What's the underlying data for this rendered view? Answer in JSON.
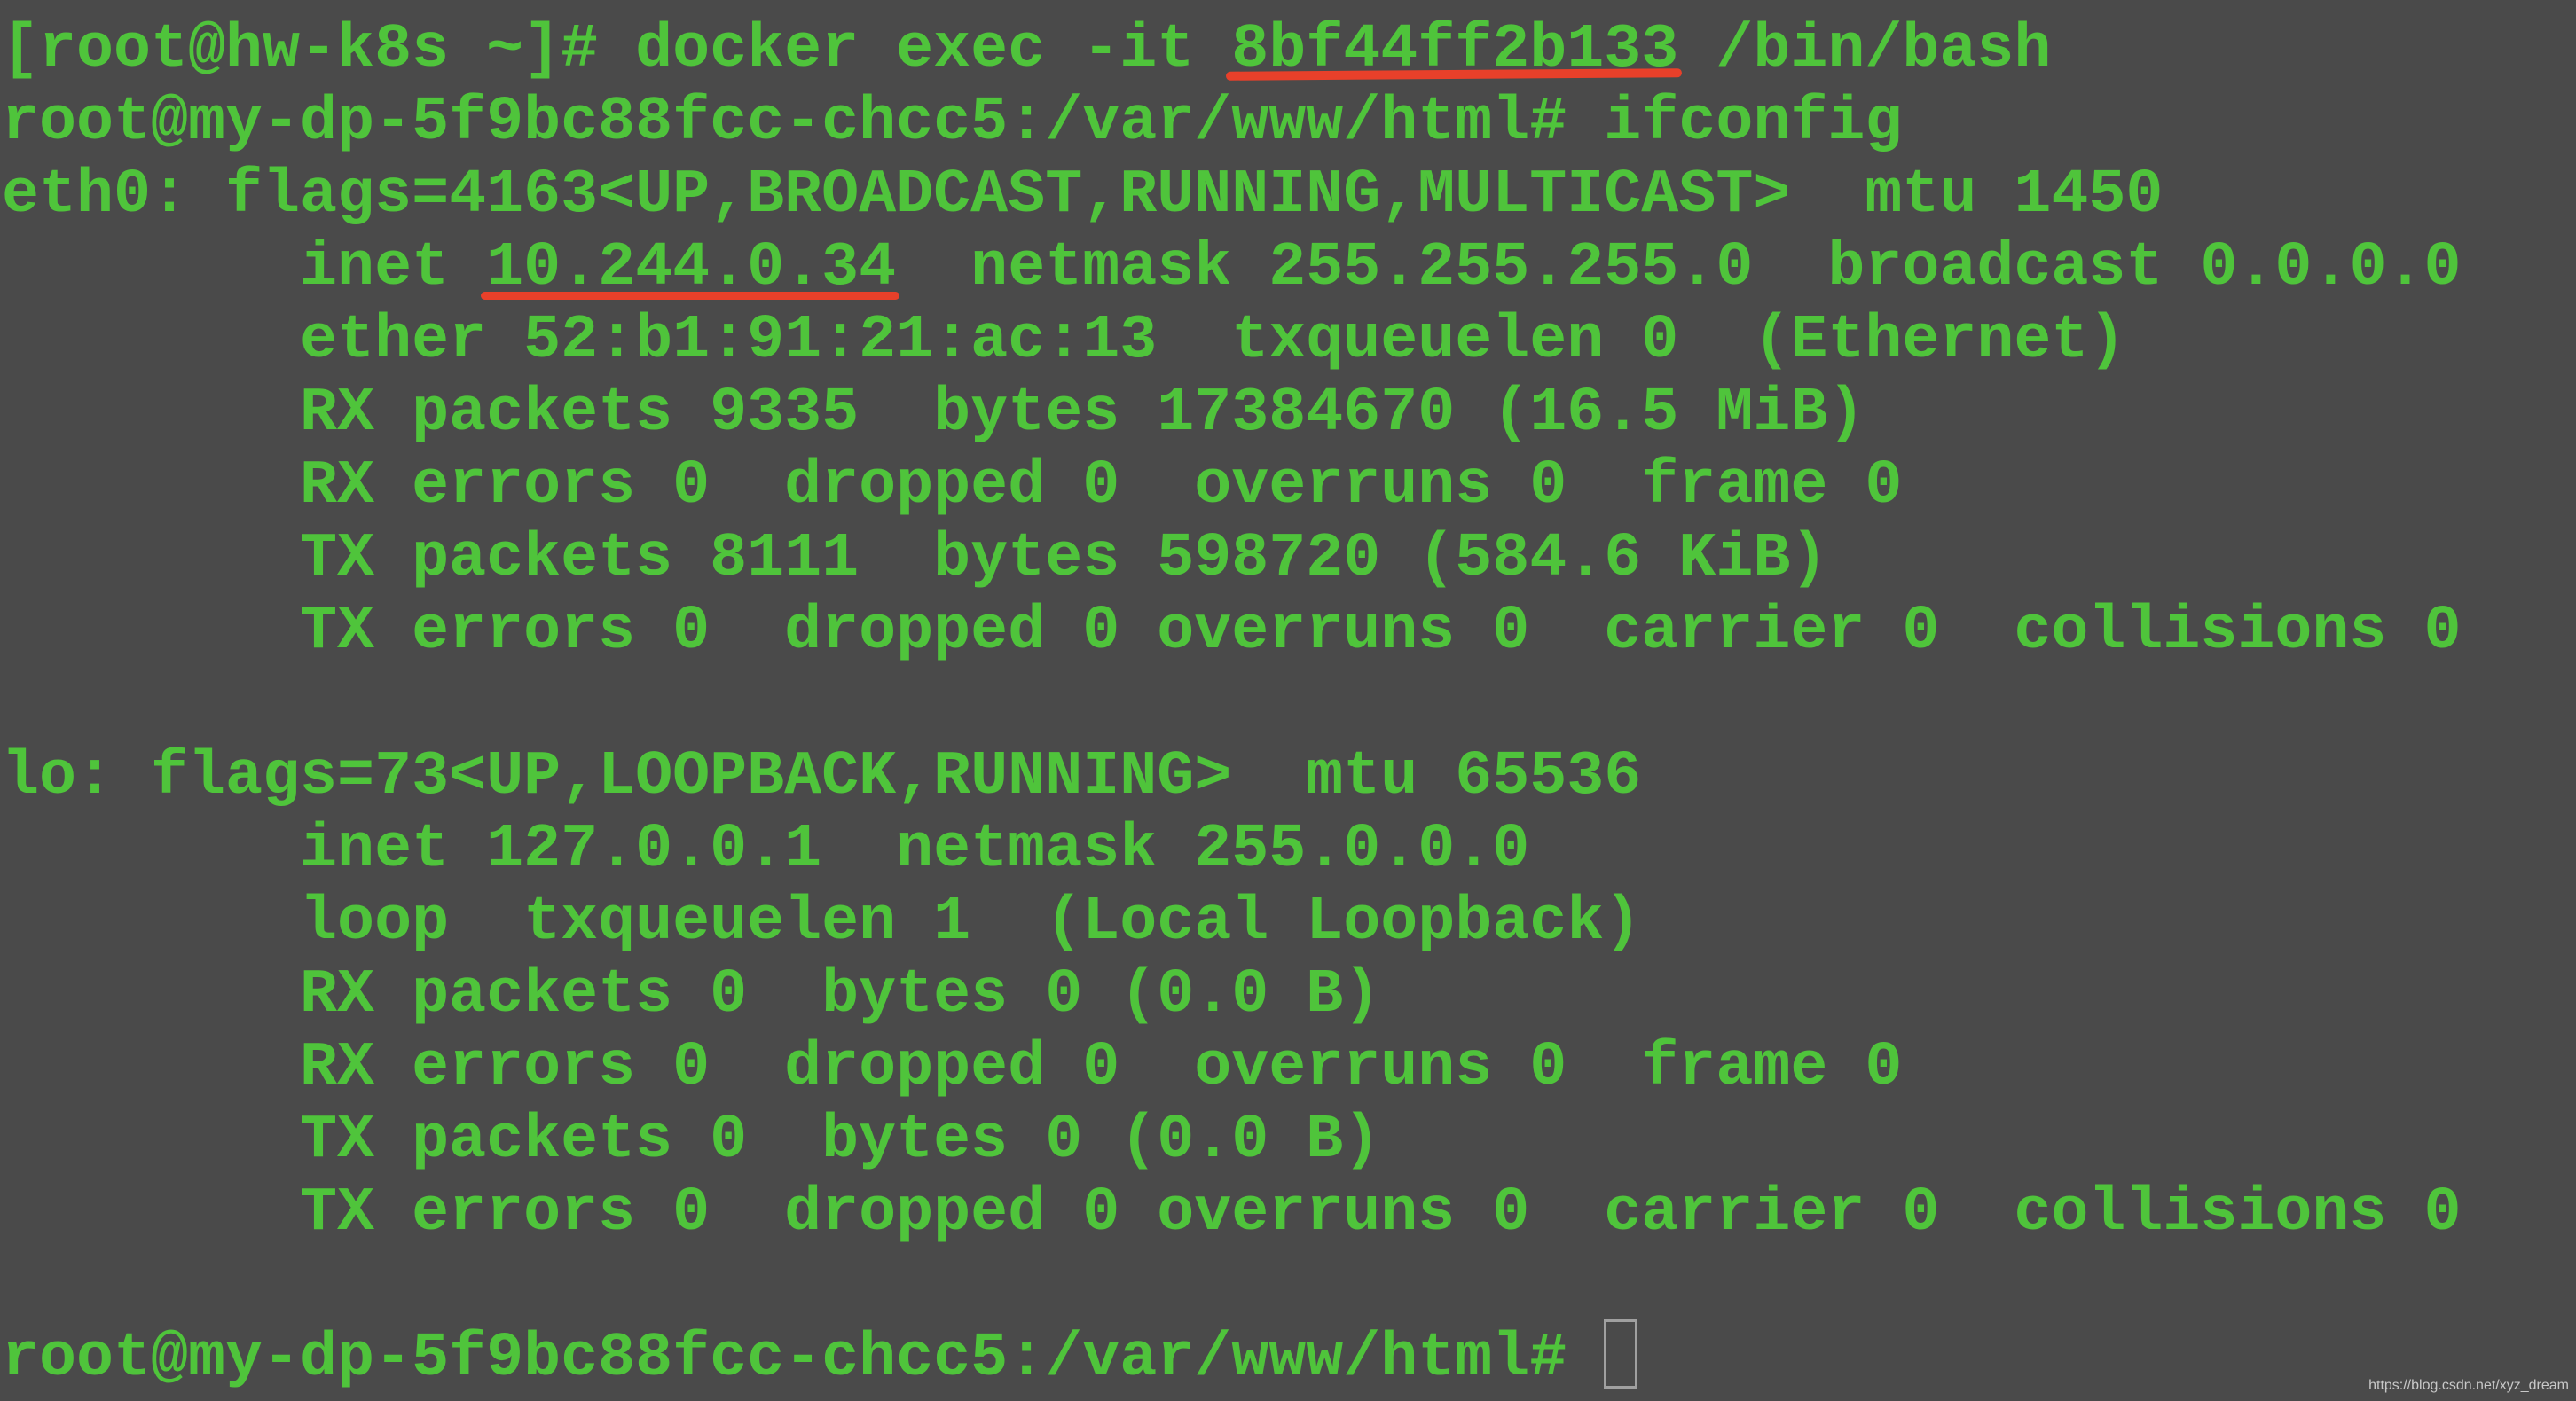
{
  "theme": {
    "background": "#4a4a4a",
    "text_color": "#4fc43b",
    "annotation_color": "#e8402a",
    "cursor_color": "#a0a0a0"
  },
  "terminal": {
    "lines": [
      {
        "pre": "[root@hw-k8s ~]# docker exec -it ",
        "highlight": "8bf44ff2b133",
        "post": " /bin/bash"
      },
      {
        "text": "root@my-dp-5f9bc88fcc-chcc5:/var/www/html# ifconfig"
      },
      {
        "text": "eth0: flags=4163<UP,BROADCAST,RUNNING,MULTICAST>  mtu 1450"
      },
      {
        "pre": "        inet ",
        "highlight": "10.244.0.34",
        "post": "  netmask 255.255.255.0  broadcast 0.0.0.0"
      },
      {
        "text": "        ether 52:b1:91:21:ac:13  txqueuelen 0  (Ethernet)"
      },
      {
        "text": "        RX packets 9335  bytes 17384670 (16.5 MiB)"
      },
      {
        "text": "        RX errors 0  dropped 0  overruns 0  frame 0"
      },
      {
        "text": "        TX packets 8111  bytes 598720 (584.6 KiB)"
      },
      {
        "text": "        TX errors 0  dropped 0 overruns 0  carrier 0  collisions 0"
      },
      {
        "text": ""
      },
      {
        "text": "lo: flags=73<UP,LOOPBACK,RUNNING>  mtu 65536"
      },
      {
        "text": "        inet 127.0.0.1  netmask 255.0.0.0"
      },
      {
        "text": "        loop  txqueuelen 1  (Local Loopback)"
      },
      {
        "text": "        RX packets 0  bytes 0 (0.0 B)"
      },
      {
        "text": "        RX errors 0  dropped 0  overruns 0  frame 0"
      },
      {
        "text": "        TX packets 0  bytes 0 (0.0 B)"
      },
      {
        "text": "        TX errors 0  dropped 0 overruns 0  carrier 0  collisions 0"
      },
      {
        "text": ""
      }
    ],
    "prompt": "root@my-dp-5f9bc88fcc-chcc5:/var/www/html# ",
    "container_id": "8bf44ff2b133",
    "highlighted_ip": "10.244.0.34"
  },
  "watermark": "https://blog.csdn.net/xyz_dream"
}
